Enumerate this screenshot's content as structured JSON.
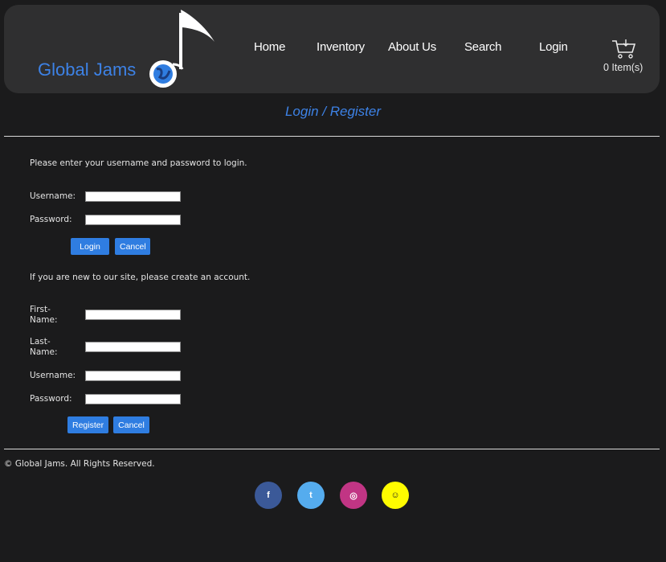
{
  "brand": {
    "name": "Global Jams"
  },
  "nav": {
    "items": [
      {
        "label": "Home"
      },
      {
        "label": "Inventory"
      },
      {
        "label": "About Us"
      },
      {
        "label": "Search"
      },
      {
        "label": "Login"
      }
    ],
    "cart": {
      "count_text": "0 Item(s)"
    }
  },
  "page": {
    "title": "Login / Register"
  },
  "login": {
    "intro": "Please enter your username and password to login.",
    "username_label": "Username:",
    "password_label": "Password:",
    "username_value": "",
    "password_value": "",
    "login_button": "Login",
    "cancel_button": "Cancel"
  },
  "register": {
    "intro": "If you are new to our site, please create an account.",
    "first_name_label_1": "First-",
    "first_name_label_2": "Name:",
    "last_name_label_1": "Last-",
    "last_name_label_2": "Name:",
    "username_label": "Username:",
    "password_label": "Password:",
    "register_button": "Register",
    "cancel_button": "Cancel"
  },
  "footer": {
    "copyright": "© Global Jams. All Rights Reserved.",
    "social": [
      {
        "icon": "facebook-icon",
        "glyph": "f",
        "color": "#3b5998"
      },
      {
        "icon": "twitter-icon",
        "glyph": "t",
        "color": "#55acee"
      },
      {
        "icon": "instagram-icon",
        "glyph": "◎",
        "color": "#c13584"
      },
      {
        "icon": "snapchat-icon",
        "glyph": "☺",
        "color": "#fffc00"
      }
    ]
  },
  "colors": {
    "accent": "#3d82e6",
    "button": "#2f7de1",
    "background": "#1b1b1c",
    "header": "#2f2f30"
  }
}
